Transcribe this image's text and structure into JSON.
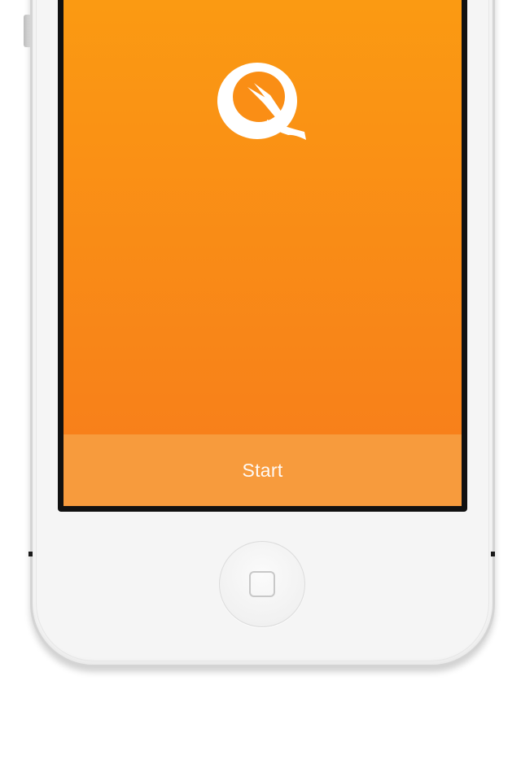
{
  "app": {
    "start_label": "Start"
  },
  "icons": {
    "logo": "q-bird-logo-icon",
    "home": "home-button-square-icon"
  },
  "colors": {
    "gradient_top": "#fb9a12",
    "gradient_bottom": "#f77c1b",
    "start_bar": "#f79b3d",
    "text": "#ffffff",
    "device_body": "#f5f5f5"
  }
}
